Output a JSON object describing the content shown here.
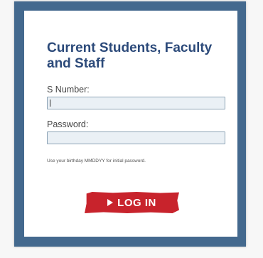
{
  "login_panel": {
    "title": "Current Students, Faculty and Staff",
    "snumber_label": "S Number:",
    "snumber_value": "",
    "password_label": "Password:",
    "password_value": "",
    "hint": "Use your birthday MMDDYY for initial password.",
    "login_button_label": "LOG IN",
    "login_button_icon": "play-arrow-icon"
  },
  "colors": {
    "frame": "#44698e",
    "title": "#2c4a7a",
    "button": "#c8232c",
    "field_bg": "#eaf0f5",
    "field_border": "#8ea4b6"
  }
}
